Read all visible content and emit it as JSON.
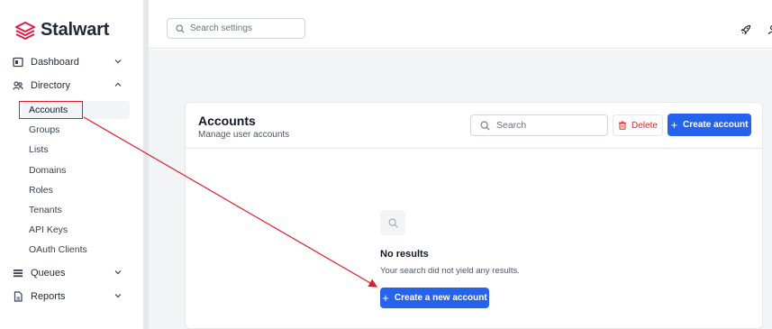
{
  "app": {
    "logo_text": "Stalwart",
    "brand_color": "#e11d48"
  },
  "sidebar": {
    "items": [
      {
        "label": "Dashboard",
        "icon": "dashboard-icon",
        "chevron": "chevron-down-icon"
      },
      {
        "label": "Directory",
        "icon": "directory-icon",
        "chevron": "chevron-up-icon"
      },
      {
        "label": "Queues",
        "icon": "queues-icon",
        "chevron": "chevron-down-icon"
      },
      {
        "label": "Reports",
        "icon": "reports-icon",
        "chevron": "chevron-down-icon"
      }
    ],
    "directory_subitems": [
      "Accounts",
      "Groups",
      "Lists",
      "Domains",
      "Roles",
      "Tenants",
      "API Keys",
      "OAuth Clients"
    ],
    "active_subitem": "Accounts"
  },
  "topbar": {
    "search_placeholder": "Search settings"
  },
  "card": {
    "title": "Accounts",
    "subtitle": "Manage user accounts",
    "search_placeholder": "Search",
    "delete_label": "Delete",
    "create_label": "Create account"
  },
  "empty_state": {
    "title": "No results",
    "description": "Your search did not yield any results.",
    "button_label": "Create a new account"
  },
  "colors": {
    "primary": "#2563eb",
    "danger": "#dc2626",
    "annotation": "#e11d2a"
  }
}
